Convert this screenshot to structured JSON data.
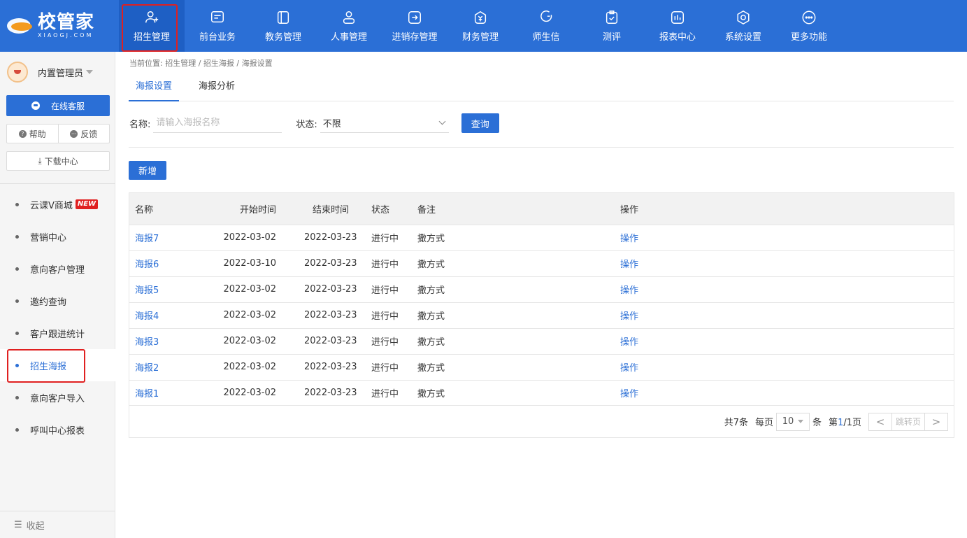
{
  "logo": {
    "cn": "校管家",
    "en": "XIAOGJ.COM"
  },
  "nav": [
    {
      "label": "招生管理",
      "icon": "user-plus-icon"
    },
    {
      "label": "前台业务",
      "icon": "desk-icon"
    },
    {
      "label": "教务管理",
      "icon": "book-icon"
    },
    {
      "label": "人事管理",
      "icon": "person-icon"
    },
    {
      "label": "进销存管理",
      "icon": "inventory-icon"
    },
    {
      "label": "财务管理",
      "icon": "yuan-icon"
    },
    {
      "label": "师生信",
      "icon": "chat-icon"
    },
    {
      "label": "测评",
      "icon": "clipboard-check-icon"
    },
    {
      "label": "报表中心",
      "icon": "report-icon"
    },
    {
      "label": "系统设置",
      "icon": "settings-icon"
    },
    {
      "label": "更多功能",
      "icon": "more-icon"
    }
  ],
  "sidebar": {
    "user_name": "内置管理员",
    "online_service": "在线客服",
    "help": "帮助",
    "feedback": "反馈",
    "download": "下载中心",
    "items": [
      {
        "label": "云课V商城",
        "badge": "NEW"
      },
      {
        "label": "营销中心"
      },
      {
        "label": "意向客户管理"
      },
      {
        "label": "邀约查询"
      },
      {
        "label": "客户跟进统计"
      },
      {
        "label": "招生海报"
      },
      {
        "label": "意向客户导入"
      },
      {
        "label": "呼叫中心报表"
      }
    ],
    "collapse": "收起"
  },
  "breadcrumb": "当前位置: 招生管理 / 招生海报 / 海报设置",
  "tabs": [
    "海报设置",
    "海报分析"
  ],
  "filter": {
    "name_label": "名称:",
    "name_placeholder": "请输入海报名称",
    "status_label": "状态:",
    "status_value": "不限",
    "query": "查询"
  },
  "add_button": "新增",
  "table": {
    "headers": [
      "名称",
      "开始时间",
      "结束时间",
      "状态",
      "备注",
      "操作"
    ],
    "rows": [
      [
        "海报7",
        "2022-03-02",
        "2022-03-23",
        "进行中",
        "撒方式",
        "操作"
      ],
      [
        "海报6",
        "2022-03-10",
        "2022-03-23",
        "进行中",
        "撒方式",
        "操作"
      ],
      [
        "海报5",
        "2022-03-02",
        "2022-03-23",
        "进行中",
        "撒方式",
        "操作"
      ],
      [
        "海报4",
        "2022-03-02",
        "2022-03-23",
        "进行中",
        "撒方式",
        "操作"
      ],
      [
        "海报3",
        "2022-03-02",
        "2022-03-23",
        "进行中",
        "撒方式",
        "操作"
      ],
      [
        "海报2",
        "2022-03-02",
        "2022-03-23",
        "进行中",
        "撒方式",
        "操作"
      ],
      [
        "海报1",
        "2022-03-02",
        "2022-03-23",
        "进行中",
        "撒方式",
        "操作"
      ]
    ]
  },
  "pager": {
    "total": "共7条",
    "per_page_label": "每页",
    "per_page": "10",
    "unit": "条",
    "page_prefix": "第",
    "page_current": "1",
    "page_suffix": "/1页",
    "jump": "跳转页",
    "prev": "<",
    "next": ">"
  },
  "colors": {
    "brand": "#2b6fd6",
    "highlight": "#e02020"
  }
}
